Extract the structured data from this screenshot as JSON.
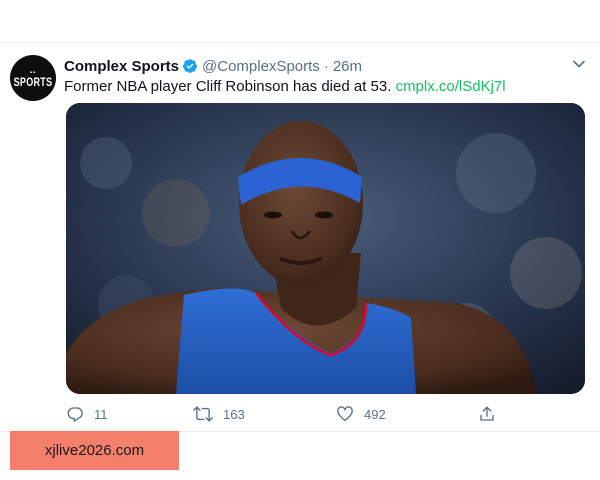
{
  "tweet": {
    "display_name": "Complex Sports",
    "handle": "@ComplexSports",
    "separator": "·",
    "time": "26m",
    "text": "Former NBA player Cliff Robinson has died at 53.",
    "link": "cmplx.co/lSdKj7l",
    "avatar": {
      "mark": "▪▪",
      "word": "SPORTS"
    },
    "media": {
      "description_icon": "photo"
    },
    "actions": {
      "reply_count": "11",
      "retweet_count": "163",
      "like_count": "492"
    }
  },
  "colors": {
    "accent_link": "#17bf63",
    "verified": "#1da1f2",
    "muted": "#5b7083",
    "watermark_bg": "#f47f6b"
  },
  "watermark": {
    "text": "xjlive2026.com"
  }
}
